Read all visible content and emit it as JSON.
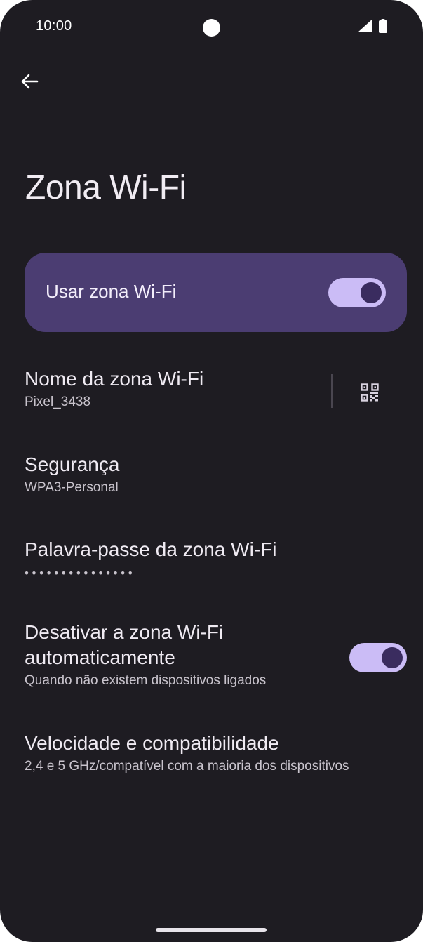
{
  "status_bar": {
    "time": "10:00",
    "icons": [
      "camera-punch-hole",
      "signal-icon",
      "battery-icon"
    ]
  },
  "navigation": {
    "back_icon": "arrow-back-icon"
  },
  "page": {
    "title": "Zona Wi-Fi"
  },
  "main_toggle": {
    "label": "Usar zona Wi-Fi",
    "checked": true
  },
  "settings": {
    "hotspot_name": {
      "title": "Nome da zona Wi-Fi",
      "value": "Pixel_3438",
      "action_icon": "qr-code-icon"
    },
    "security": {
      "title": "Segurança",
      "value": "WPA3-Personal"
    },
    "password": {
      "title": "Palavra-passe da zona Wi-Fi",
      "value": "•••••••••••••••"
    },
    "auto_off": {
      "title_line1": "Desativar a zona Wi-Fi",
      "title_line2": "automaticamente",
      "subtitle": "Quando não existem dispositivos ligados",
      "checked": true
    },
    "speed": {
      "title": "Velocidade e compatibilidade",
      "value": "2,4 e 5 GHz/compatível com a maioria dos dispositivos"
    }
  },
  "colors": {
    "background": "#1e1c22",
    "card": "#4b3d72",
    "switch_track": "#cbbcf6",
    "switch_thumb": "#3a2c5f",
    "text_primary": "#efeaf2",
    "text_secondary": "#c9c4cd"
  }
}
